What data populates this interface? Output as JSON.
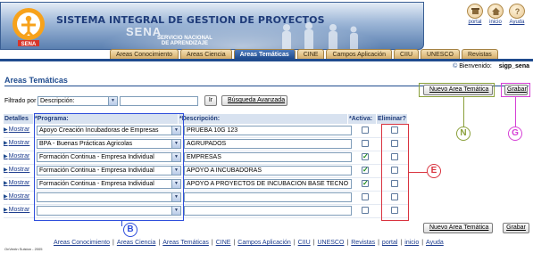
{
  "header": {
    "system_title": "SISTEMA INTEGRAL DE GESTION DE PROYECTOS",
    "brand_big": "SENA",
    "brand_sub_1": "SERVICIO NACIONAL",
    "brand_sub_2": "DE APRENDIZAJE",
    "logo_text": "SENA",
    "top_links": [
      "portal",
      "inicio",
      "Ayuda"
    ]
  },
  "tabs": [
    "Areas Conocimiento",
    "Areas Ciencia",
    "Areas Temáticas",
    "CINE",
    "Campos Aplicación",
    "CIIU",
    "UNESCO",
    "Revistas"
  ],
  "active_tab": "Areas Temáticas",
  "welcome": {
    "label": "Bienvenido:",
    "user": "sigp_sena",
    "icon": "©"
  },
  "page_title": "Areas Temáticas",
  "actions": {
    "new_label": "Nuevo Area Temática",
    "save_label": "Grabar"
  },
  "filter": {
    "label": "Filtrado por",
    "field_value": "Descripción:",
    "text_value": "",
    "go_label": "Ir",
    "advanced_label": "Búsqueda Avanzada"
  },
  "grid": {
    "columns": [
      "Detalles",
      "*Programa:",
      "*Descripción:",
      "*Activa:",
      "Eliminar?"
    ],
    "detail_link": "Mostrar",
    "rows": [
      {
        "programa": "Apoyo Creación Incubadoras de Empresas",
        "descripcion": "PRUEBA 10G 123",
        "activa": false
      },
      {
        "programa": "BPA - Buenas Prácticas Agricolas",
        "descripcion": "AGRUPADOS",
        "activa": false
      },
      {
        "programa": "Formación Continua - Empresa Individual",
        "descripcion": "EMPRESAS",
        "activa": true
      },
      {
        "programa": "Formación Continua - Empresa Individual",
        "descripcion": "APOYO A INCUBADORAS",
        "activa": true
      },
      {
        "programa": "Formación Continua - Empresa Individual",
        "descripcion": "APOYO A PROYECTOS DE INCUBACION BASE TECNO",
        "activa": true
      },
      {
        "programa": "",
        "descripcion": "",
        "activa": false
      },
      {
        "programa": "",
        "descripcion": "",
        "activa": false
      }
    ]
  },
  "callouts": {
    "b": "B",
    "e": "E",
    "n": "N",
    "g": "G"
  },
  "footer": {
    "links": [
      "Areas Conocimiento",
      "Areas Ciencia",
      "Areas Temáticas",
      "CINE",
      "Campos Aplicación",
      "CIIU",
      "UNESCO",
      "Revistas",
      "portal",
      "inicio",
      "Ayuda"
    ],
    "note": "OnVentn Sulston - 2005"
  },
  "colors": {
    "primary": "#1f4b8e",
    "tab_bg": "#d5ad68",
    "callout_blue": "#2f4fdc",
    "callout_red": "#d9333f",
    "callout_olive": "#8aa03a",
    "callout_pink": "#d640d6"
  }
}
